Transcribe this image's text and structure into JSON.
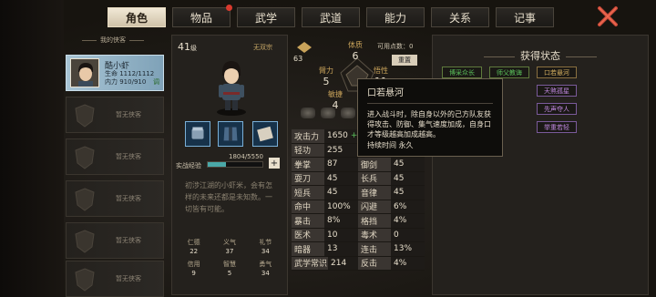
{
  "tabs": [
    {
      "label": "角色",
      "active": true
    },
    {
      "label": "物品",
      "badge": true
    },
    {
      "label": "武学"
    },
    {
      "label": "武道"
    },
    {
      "label": "能力"
    },
    {
      "label": "关系"
    },
    {
      "label": "记事"
    }
  ],
  "roster": {
    "title": "我的侠客",
    "hero": {
      "name": "酷小虾",
      "hp": "生命 1112/1112",
      "mp": "内力 910/910",
      "tag": "调"
    },
    "empty_label": "暂无侠客"
  },
  "character": {
    "level": "41",
    "level_unit": "级",
    "sect": "无双宗",
    "exp_label": "实战经验",
    "exp_text": "1804/5550",
    "exp_fraction": 0.325,
    "bio": "初涉江湖的小虾米，会有怎样的未来还都是未知数。一切皆有可能。",
    "virtues": [
      {
        "k": "仁德",
        "v": "22"
      },
      {
        "k": "义气",
        "v": "37"
      },
      {
        "k": "礼节",
        "v": "34"
      },
      {
        "k": "信用",
        "v": "9"
      },
      {
        "k": "智慧",
        "v": "5"
      },
      {
        "k": "勇气",
        "v": "34"
      }
    ]
  },
  "attributes": {
    "free_points": "可用点数：0",
    "reset": "重置",
    "rank_value": "63",
    "tizhi": {
      "n": "体质",
      "v": "6"
    },
    "biyi": {
      "n": "臂力",
      "v": "5"
    },
    "wuxing": {
      "n": "悟性",
      "v": "11"
    },
    "minjie": {
      "n": "敏捷",
      "v": "4"
    }
  },
  "stats": [
    [
      {
        "k": "攻击力",
        "v": "1650",
        "g": "+183"
      }
    ],
    [
      {
        "k": "轻功",
        "v": "255"
      }
    ],
    [
      {
        "k": "拳掌",
        "v": "87"
      },
      {
        "k": "御剑",
        "v": "45"
      }
    ],
    [
      {
        "k": "耍刀",
        "v": "45"
      },
      {
        "k": "长兵",
        "v": "45"
      }
    ],
    [
      {
        "k": "短兵",
        "v": "45"
      },
      {
        "k": "音律",
        "v": "45"
      }
    ],
    [
      {
        "k": "命中",
        "v": "100%"
      },
      {
        "k": "闪避",
        "v": "6%"
      }
    ],
    [
      {
        "k": "暴击",
        "v": "8%"
      },
      {
        "k": "格挡",
        "v": "4%"
      }
    ],
    [
      {
        "k": "医术",
        "v": "10"
      },
      {
        "k": "毒术",
        "v": "0"
      }
    ],
    [
      {
        "k": "暗器",
        "v": "13"
      },
      {
        "k": "连击",
        "v": "13%"
      }
    ],
    [
      {
        "k": "武学常识",
        "v": "214"
      },
      {
        "k": "反击",
        "v": "4%"
      }
    ]
  ],
  "tooltip": {
    "title": "口若悬河",
    "body": "进入战斗时，除自身以外的己方队友获得攻击、防御、集气速度加成，自身口才等级越高加成越高。",
    "duration": "持续时间  永久"
  },
  "status_panel": {
    "title": "获得状态",
    "items": [
      {
        "label": "博采众长",
        "color": "green"
      },
      {
        "label": "师父教诲",
        "color": "green"
      },
      {
        "label": "口若悬河",
        "color": "gold"
      },
      {
        "label": "天煞孤星",
        "color": "purple"
      },
      {
        "label": "先声夺人",
        "color": "purple"
      },
      {
        "label": "举重若轻",
        "color": "purple"
      }
    ]
  }
}
